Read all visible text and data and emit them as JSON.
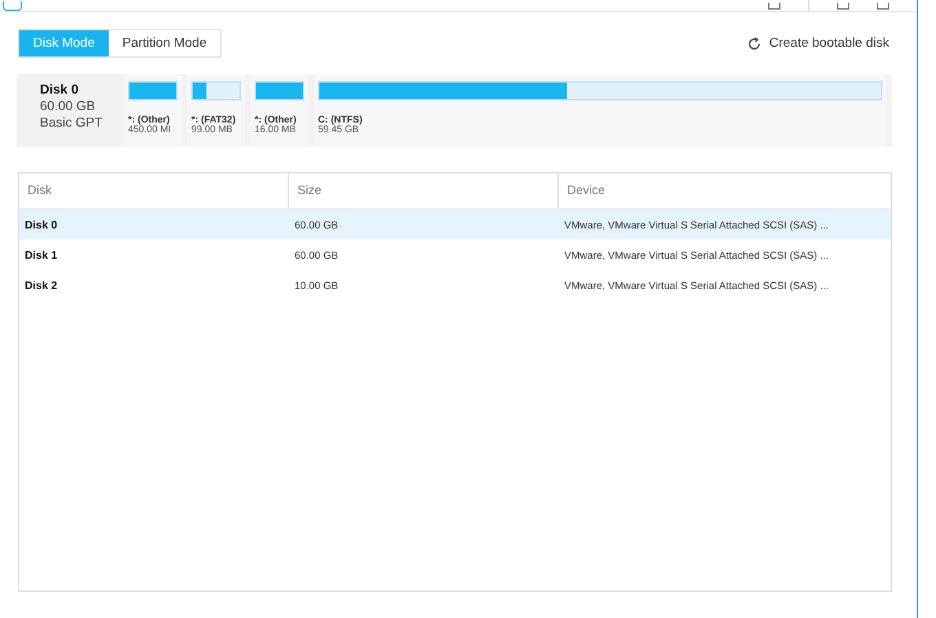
{
  "mode_tabs": [
    {
      "label": "Disk Mode",
      "selected": true
    },
    {
      "label": "Partition Mode",
      "selected": false
    }
  ],
  "create_bootable": {
    "label": "Create bootable disk"
  },
  "disk_map": {
    "name": "Disk 0",
    "size": "60.00 GB",
    "type": "Basic GPT",
    "partitions": [
      {
        "label": "*: (Other)",
        "size": "450.00 MI",
        "level": 1.0,
        "wide": false
      },
      {
        "label": "*: (FAT32)",
        "size": "99.00 MB",
        "level": 0.28,
        "wide": false
      },
      {
        "label": "*: (Other)",
        "size": "16.00 MB",
        "level": 1.0,
        "wide": false
      },
      {
        "label": "C: (NTFS)",
        "size": "59.45 GB",
        "level": 0.44,
        "wide": true
      }
    ]
  },
  "table": {
    "columns": [
      "Disk",
      "Size",
      "Device"
    ],
    "rows": [
      {
        "disk": "Disk 0",
        "size": "60.00 GB",
        "device": "VMware,  VMware Virtual S Serial Attached SCSI (SAS) ...",
        "selected": true
      },
      {
        "disk": "Disk 1",
        "size": "60.00 GB",
        "device": "VMware,  VMware Virtual S Serial Attached SCSI (SAS) ...",
        "selected": false
      },
      {
        "disk": "Disk 2",
        "size": "10.00 GB",
        "device": "VMware,  VMware Virtual S Serial Attached SCSI (SAS) ...",
        "selected": false
      }
    ]
  }
}
